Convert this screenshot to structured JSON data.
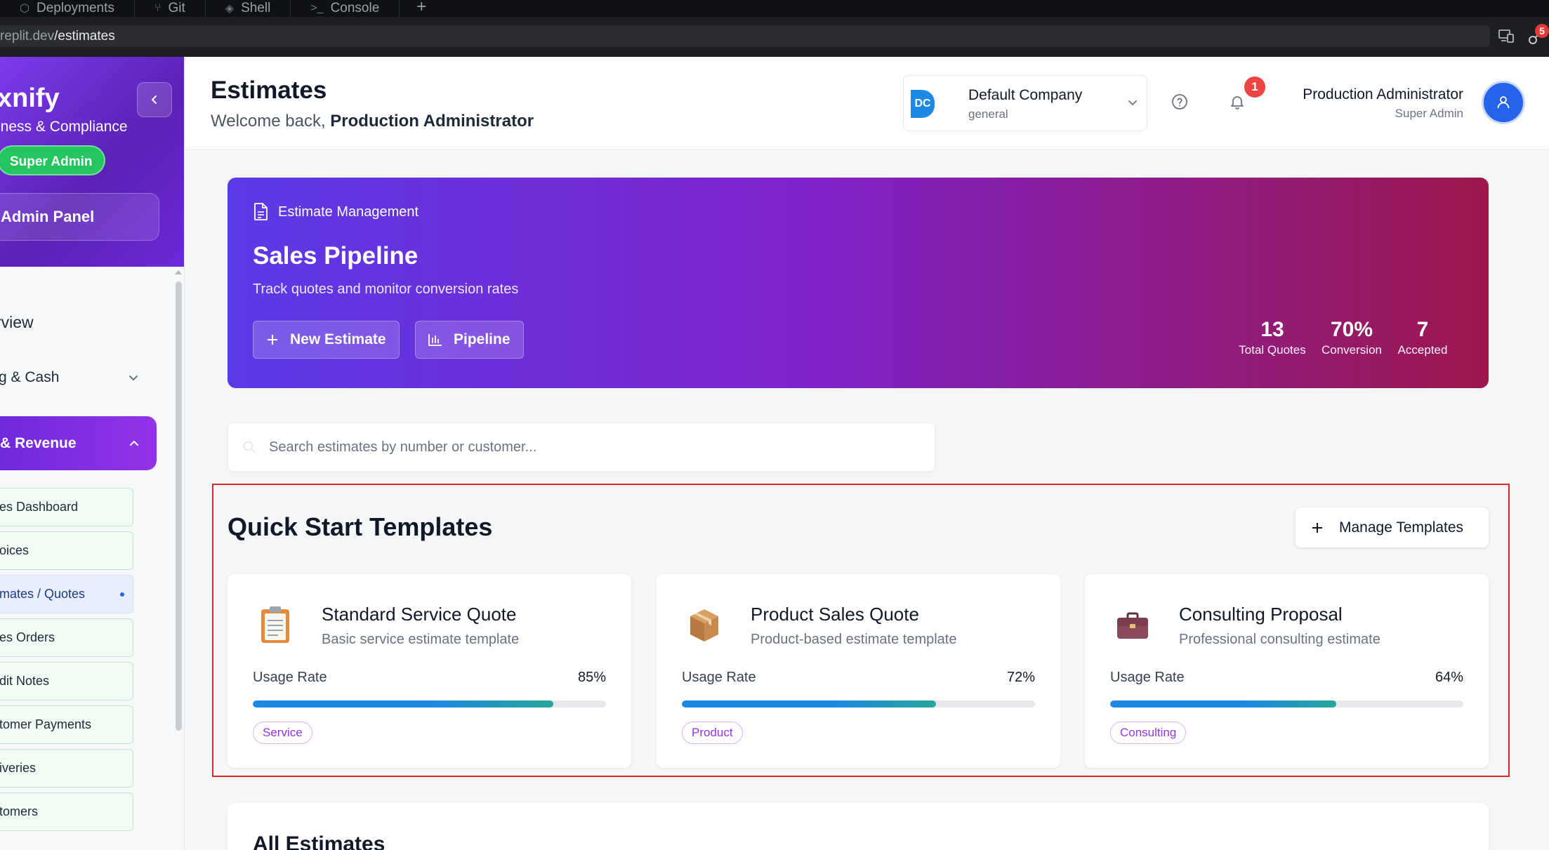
{
  "browser": {
    "tabs": [
      {
        "label": "Deployments",
        "icon": "deployments-icon"
      },
      {
        "label": "Git",
        "icon": "git-icon"
      },
      {
        "label": "Shell",
        "icon": "shell-icon"
      },
      {
        "label": "Console",
        "icon": "console-icon"
      }
    ],
    "new_tab": "+",
    "url_domain": "replit.dev",
    "url_path": "/estimates",
    "extension_badge": "5"
  },
  "sidebar": {
    "brand": "xnify",
    "brand_sub": "iness & Compliance",
    "role_badge": "Super Admin",
    "admin_panel": "Admin Panel",
    "nav_overview": "rview",
    "nav_banking": "g & Cash",
    "nav_sales": "& Revenue",
    "sub_items": [
      {
        "label": "es Dashboard",
        "active": false
      },
      {
        "label": "oices",
        "active": false
      },
      {
        "label": "mates / Quotes",
        "active": true
      },
      {
        "label": "es Orders",
        "active": false
      },
      {
        "label": "dit Notes",
        "active": false
      },
      {
        "label": "tomer Payments",
        "active": false
      },
      {
        "label": "iveries",
        "active": false
      },
      {
        "label": "tomers",
        "active": false
      }
    ]
  },
  "header": {
    "title": "Estimates",
    "welcome_prefix": "Welcome back,",
    "welcome_name": "Production Administrator",
    "company_initials": "DC",
    "company_name": "Default Company",
    "company_type": "general",
    "notification_count": "1",
    "user_name": "Production Administrator",
    "user_role": "Super Admin"
  },
  "hero": {
    "tag": "Estimate Management",
    "title": "Sales Pipeline",
    "subtitle": "Track quotes and monitor conversion rates",
    "new_estimate": "New Estimate",
    "pipeline": "Pipeline",
    "stats": [
      {
        "value": "13",
        "label": "Total Quotes"
      },
      {
        "value": "70%",
        "label": "Conversion"
      },
      {
        "value": "7",
        "label": "Accepted"
      }
    ]
  },
  "search": {
    "placeholder": "Search estimates by number or customer..."
  },
  "templates": {
    "title": "Quick Start Templates",
    "manage_button": "Manage Templates",
    "usage_label": "Usage Rate",
    "items": [
      {
        "name": "Standard Service Quote",
        "description": "Basic service estimate template",
        "usage": "85%",
        "usage_value": 85,
        "tag": "Service",
        "icon": "clipboard-icon"
      },
      {
        "name": "Product Sales Quote",
        "description": "Product-based estimate template",
        "usage": "72%",
        "usage_value": 72,
        "tag": "Product",
        "icon": "package-icon"
      },
      {
        "name": "Consulting Proposal",
        "description": "Professional consulting estimate",
        "usage": "64%",
        "usage_value": 64,
        "tag": "Consulting",
        "icon": "briefcase-icon"
      }
    ]
  },
  "all_estimates": {
    "title": "All Estimates"
  },
  "colors": {
    "accent": "#7c3aed",
    "progress_blue": "#1e88e5",
    "progress_teal": "#26a69a",
    "badge_red": "#ef4444",
    "role_green": "#22c55e"
  }
}
